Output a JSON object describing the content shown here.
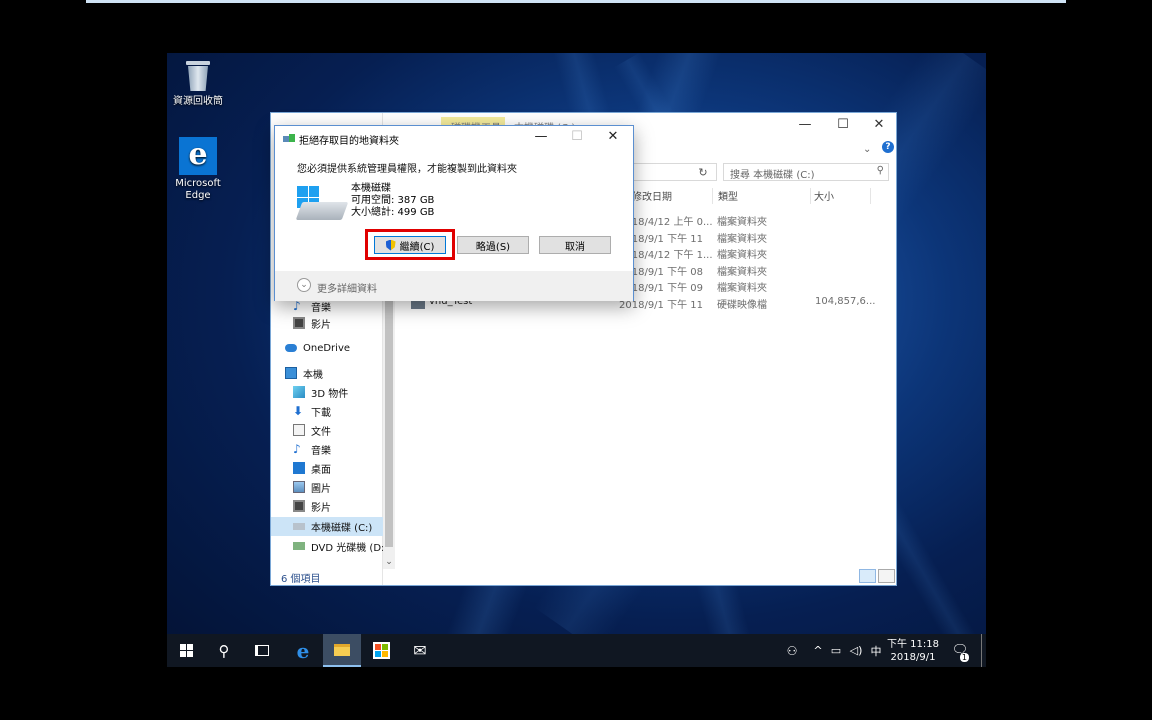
{
  "desktop": {
    "icons": [
      {
        "label": "資源回收筒",
        "icon": "recycle-bin-icon"
      },
      {
        "label": "Microsoft Edge",
        "icon": "edge-icon"
      }
    ]
  },
  "explorer": {
    "ribbon_tabs": [
      "磁碟機工具",
      "本機磁碟 (C:)"
    ],
    "search_placeholder": "搜尋 本機磁碟 (C:)",
    "columns": [
      "修改日期",
      "類型",
      "大小"
    ],
    "rows": [
      {
        "name": "",
        "date": "2018/4/12 上午 0...",
        "type": "檔案資料夾",
        "size": ""
      },
      {
        "name": "",
        "date": "2018/9/1 下午 11",
        "type": "檔案資料夾",
        "size": ""
      },
      {
        "name": "",
        "date": "2018/4/12 下午 1...",
        "type": "檔案資料夾",
        "size": ""
      },
      {
        "name": "",
        "date": "2018/9/1 下午 08",
        "type": "檔案資料夾",
        "size": ""
      },
      {
        "name": "",
        "date": "2018/9/1 下午 09",
        "type": "檔案資料夾",
        "size": ""
      },
      {
        "name": "vhd_Test",
        "date": "2018/9/1 下午 11",
        "type": "硬碟映像檔",
        "size": "104,857,6..."
      }
    ],
    "nav": {
      "music_partial": "音樂",
      "videos_quick": "影片",
      "onedrive": "OneDrive",
      "this_pc": "本機",
      "objects3d": "3D 物件",
      "downloads": "下載",
      "documents": "文件",
      "music": "音樂",
      "desktop": "桌面",
      "pictures": "圖片",
      "videos": "影片",
      "drive_c": "本機磁碟 (C:)",
      "drive_d": "DVD 光碟機 (D:)"
    },
    "status": "6 個項目"
  },
  "dialog": {
    "title": "拒絕存取目的地資料夾",
    "message": "您必須提供系統管理員權限，才能複製到此資料夾",
    "drive_name": "本機磁碟",
    "free_space": "可用空間: 387 GB",
    "total_size": "大小總計: 499 GB",
    "continue_label": "繼續(C)",
    "skip_label": "略過(S)",
    "cancel_label": "取消",
    "more_details": "更多詳細資料",
    "highlight_color": "#e00000"
  },
  "taskbar": {
    "time": "下午 11:18",
    "date": "2018/9/1",
    "ime": "中",
    "notification_count": "1",
    "accent": "#0078d7"
  }
}
